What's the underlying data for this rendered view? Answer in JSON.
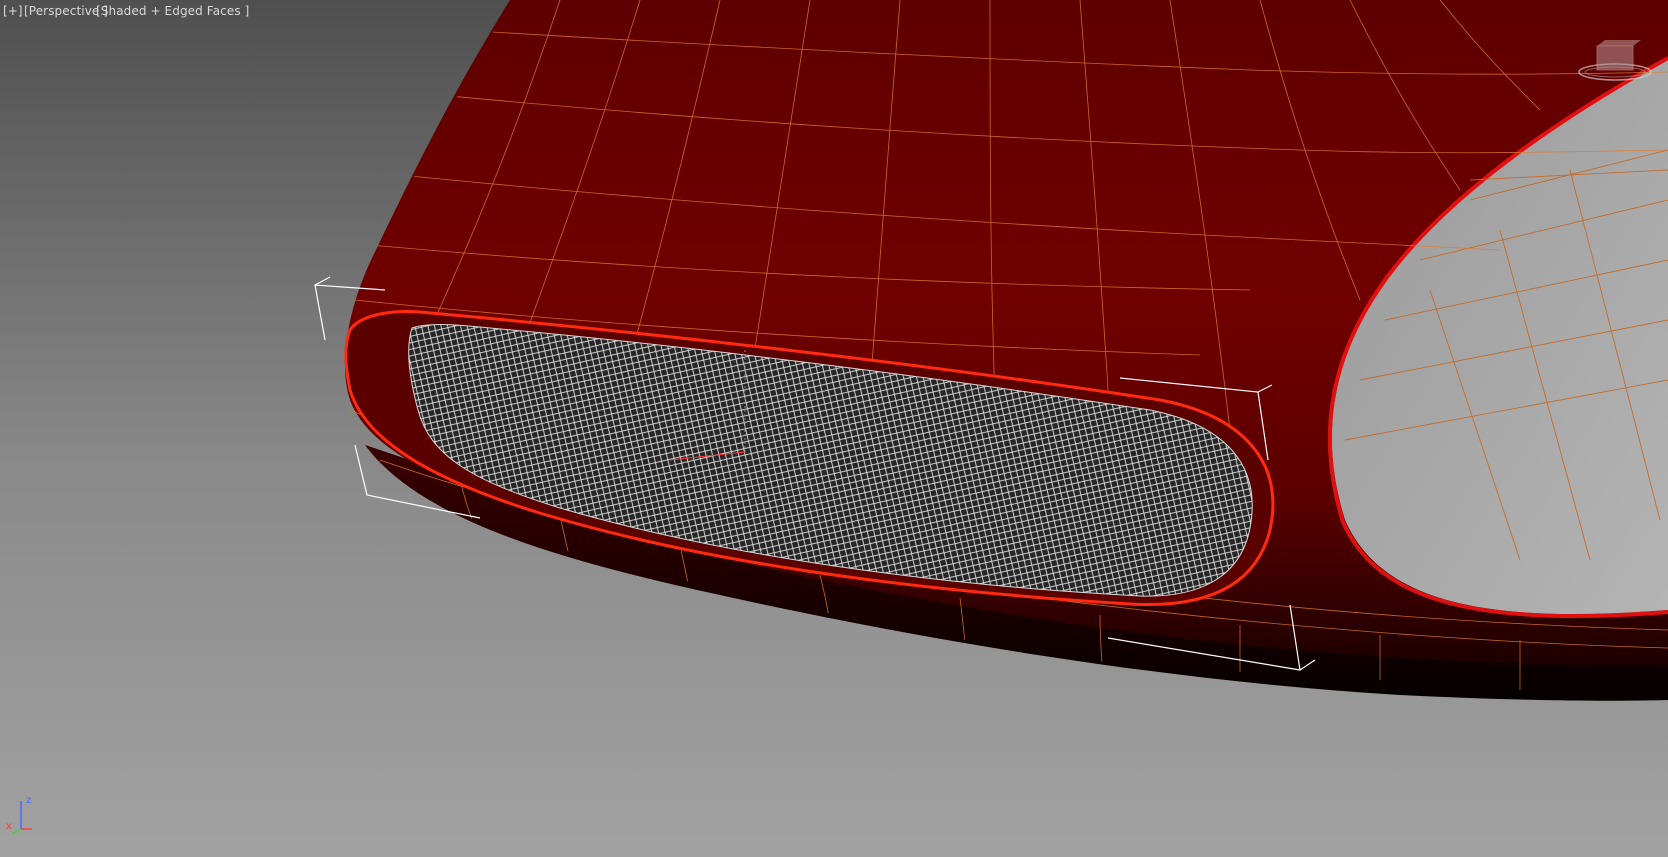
{
  "viewport": {
    "menu_label": "[+]",
    "view_label": "[Perspective ]",
    "shading_label": "[Shaded + Edged Faces ]"
  },
  "axis_tripod": {
    "z_label": "z",
    "x_label": "x"
  },
  "colors": {
    "background_top": "#4f4f4f",
    "background_bottom": "#a2a2a2",
    "body_red": "#6e0000",
    "edge_orange": "#e07a30",
    "mesh_white": "#e8e8e8"
  },
  "icons": {
    "viewcube": "viewcube-icon",
    "axis": "axis-tripod-icon"
  }
}
